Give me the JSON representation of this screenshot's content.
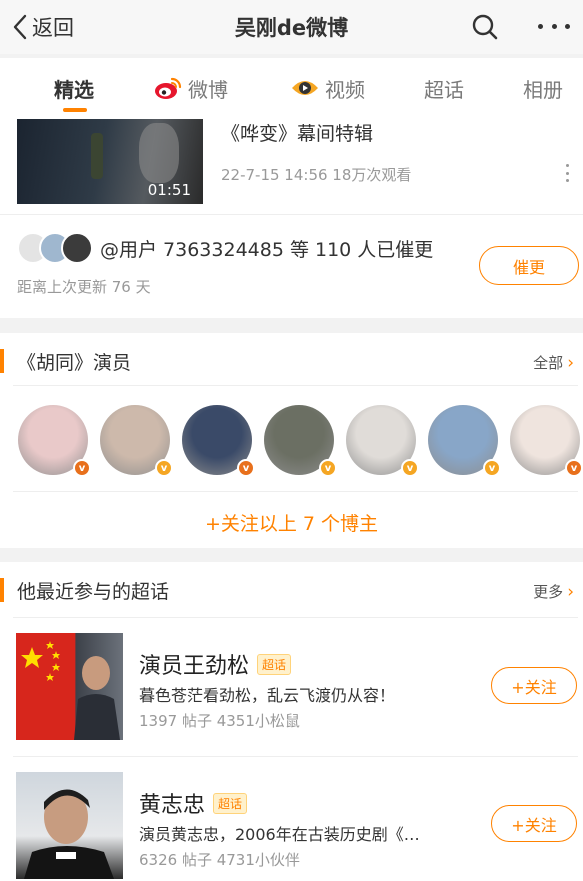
{
  "header": {
    "back_label": "返回",
    "title": "吴刚de微博"
  },
  "tabs": [
    {
      "label": "精选",
      "icon": ""
    },
    {
      "label": "微博",
      "icon": "weibo-logo-icon"
    },
    {
      "label": "视频",
      "icon": "video-eye-icon"
    },
    {
      "label": "超话",
      "icon": ""
    },
    {
      "label": "相册",
      "icon": ""
    }
  ],
  "video": {
    "duration": "01:51",
    "title": "《哗变》幕间特辑",
    "meta": "22-7-15 14:56 18万次观看"
  },
  "remind": {
    "text": "@用户 7363324485 等 110 人已催更",
    "subtext": "距离上次更新 76 天",
    "button": "催更"
  },
  "cast_section": {
    "title": "《胡同》演员",
    "link": "全部",
    "follow_all": "+关注以上 7 个博主",
    "avatar_colors": [
      "#e9c9c9",
      "#cdb9ab",
      "#3a4a68",
      "#6b6f63",
      "#e0dcd8",
      "#88a6c8",
      "#efe4de"
    ],
    "badge_colors": [
      "#e8701c",
      "#f5a623",
      "#e8701c",
      "#f5a623",
      "#f5a623",
      "#f5a623",
      "#e8701c"
    ]
  },
  "topics_section": {
    "title": "他最近参与的超话",
    "link": "更多",
    "topics": [
      {
        "name": "演员王劲松",
        "tag": "超话",
        "desc": "暮色苍茫看劲松，乱云飞渡仍从容！",
        "stats": "1397 帖子 4351小松鼠",
        "button": "+关注"
      },
      {
        "name": "黄志忠",
        "tag": "超话",
        "desc": "演员黄志忠，2006年在古装历史剧《…",
        "stats": "6326 帖子 4731小伙伴",
        "button": "+关注"
      }
    ]
  },
  "colors": {
    "accent": "#ff8200",
    "text": "#333333",
    "muted": "#999999"
  }
}
